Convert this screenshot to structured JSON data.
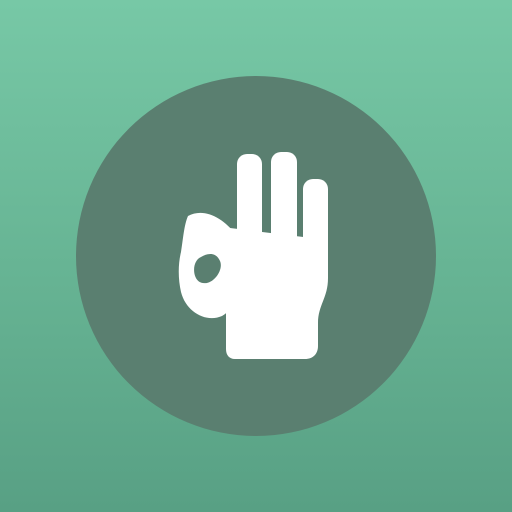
{
  "app_icon": {
    "icon": "ok-hand-gesture-icon",
    "colors": {
      "background_top": "#77c8a6",
      "background_bottom": "#58a084",
      "badge": "#5a7f70",
      "glyph": "#ffffff"
    }
  }
}
